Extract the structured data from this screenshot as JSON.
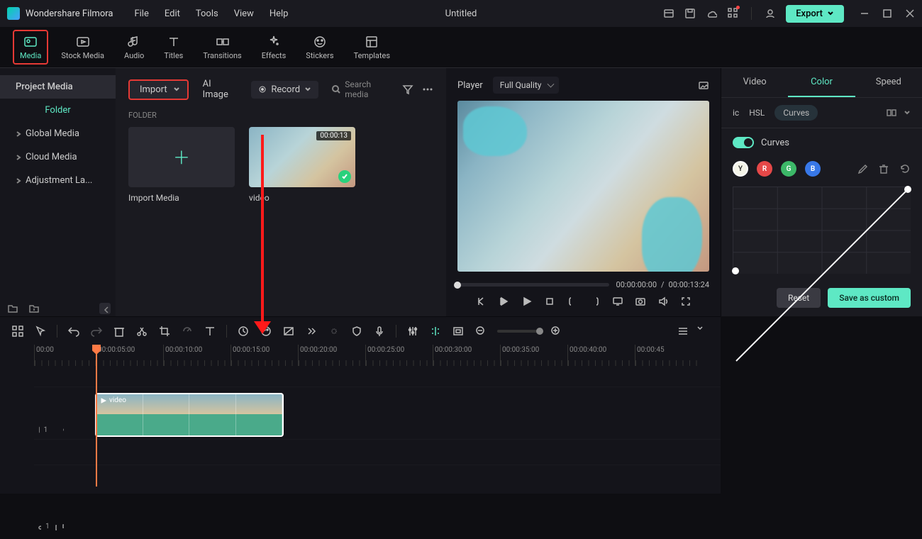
{
  "app_name": "Wondershare Filmora",
  "doc_title": "Untitled",
  "menu": [
    "File",
    "Edit",
    "Tools",
    "View",
    "Help"
  ],
  "export_label": "Export",
  "tabs": [
    {
      "label": "Media",
      "active": true
    },
    {
      "label": "Stock Media"
    },
    {
      "label": "Audio"
    },
    {
      "label": "Titles"
    },
    {
      "label": "Transitions"
    },
    {
      "label": "Effects"
    },
    {
      "label": "Stickers"
    },
    {
      "label": "Templates"
    }
  ],
  "sidebar": {
    "items": [
      "Project Media",
      "Folder",
      "Global Media",
      "Cloud Media",
      "Adjustment La..."
    ],
    "selected": 0
  },
  "content": {
    "import_label": "Import",
    "ai_label": "AI Image",
    "record_label": "Record",
    "search_placeholder": "Search media",
    "section": "FOLDER",
    "thumbs": [
      {
        "label": "Import Media",
        "type": "add"
      },
      {
        "label": "video",
        "type": "clip",
        "duration": "00:00:13",
        "checked": true
      }
    ]
  },
  "preview": {
    "player_label": "Player",
    "quality": "Full Quality",
    "time_current": "00:00:00:00",
    "time_total": "00:00:13:24"
  },
  "right_panel": {
    "tabs": [
      "Video",
      "Color",
      "Speed"
    ],
    "active_tab": 1,
    "sub_tabs": [
      "ic",
      "HSL",
      "Curves"
    ],
    "active_sub": "Curves",
    "toggle_label": "Curves",
    "toggle_on": true,
    "channels": [
      "Y",
      "R",
      "G",
      "B"
    ],
    "reset_label": "Reset",
    "save_label": "Save as custom"
  },
  "timeline": {
    "ruler": [
      "00:00",
      "00:00:05:00",
      "00:00:10:00",
      "00:00:15:00",
      "00:00:20:00",
      "00:00:25:00",
      "00:00:30:00",
      "00:00:35:00",
      "00:00:40:00",
      "00:00:45"
    ],
    "clip_label": "video",
    "video_track": "1",
    "audio_track": "1"
  }
}
